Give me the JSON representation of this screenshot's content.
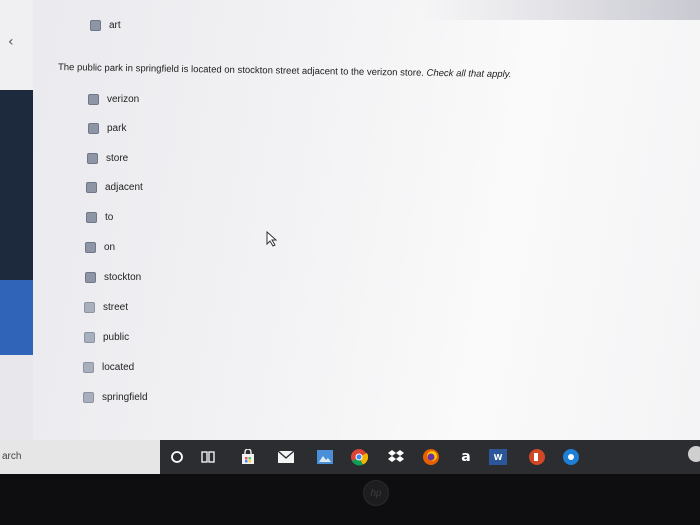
{
  "top_option": {
    "label": "art"
  },
  "question": {
    "text": "The public park in springfield is located on stockton street adjacent to the verizon store.",
    "instruction": "Check all that apply."
  },
  "options": [
    {
      "label": "verizon"
    },
    {
      "label": "park"
    },
    {
      "label": "store"
    },
    {
      "label": "adjacent"
    },
    {
      "label": "to"
    },
    {
      "label": "on"
    },
    {
      "label": "stockton"
    },
    {
      "label": "street"
    },
    {
      "label": "public"
    },
    {
      "label": "located"
    },
    {
      "label": "springfield"
    }
  ],
  "taskbar": {
    "search_text": "arch",
    "amazon_label": "a",
    "word_label": "W"
  }
}
